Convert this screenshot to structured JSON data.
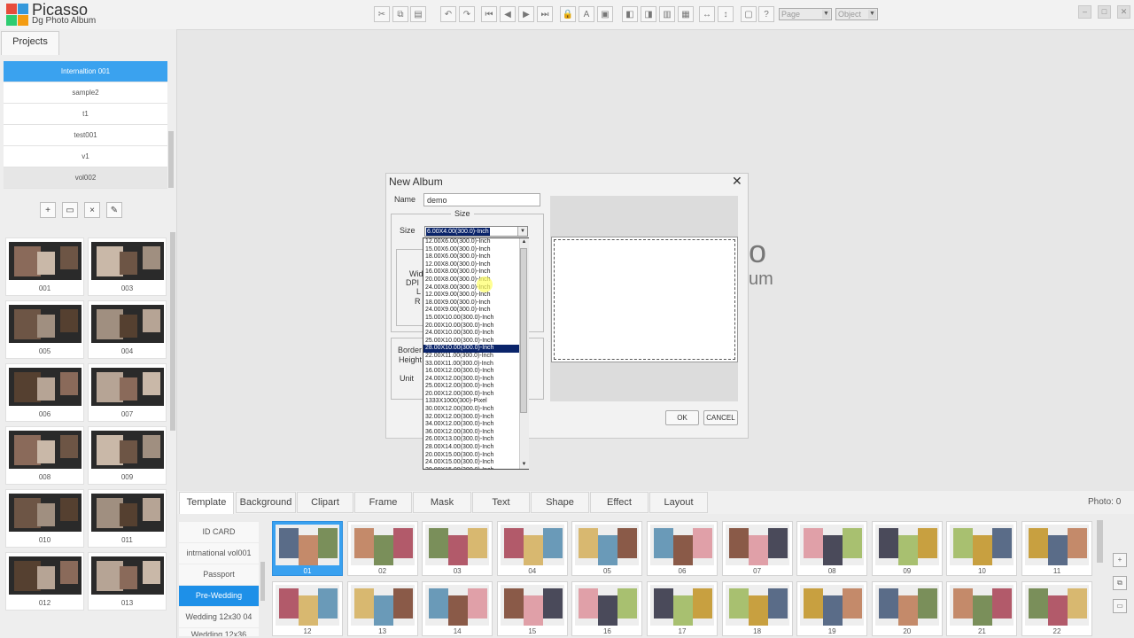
{
  "app": {
    "brand": "Picasso",
    "subtitle": "Dg Photo Album"
  },
  "toolbar": {
    "page_select": "Page",
    "object_select": "Object",
    "icons": [
      "scissors-icon",
      "copy-icon",
      "paste-icon",
      "undo-icon",
      "redo-icon",
      "first-page-icon",
      "prev-page-icon",
      "next-page-icon",
      "last-page-icon",
      "lock-icon",
      "text-layer-icon",
      "photo-layer-icon",
      "bring-front-icon",
      "send-back-icon",
      "bring-forward-icon",
      "send-backward-icon",
      "align-horizontal-icon",
      "align-vertical-icon",
      "comment-icon",
      "help-icon"
    ]
  },
  "left_panel": {
    "tab_label": "Projects",
    "projects": [
      "Internaltion 001",
      "sample2",
      "t1",
      "test001",
      "v1",
      "vol002"
    ],
    "selected_project": "Internaltion 001",
    "thumbnails": [
      "001",
      "003",
      "005",
      "004",
      "006",
      "007",
      "008",
      "009",
      "010",
      "011",
      "012",
      "013"
    ]
  },
  "workspace": {
    "bg_text_1": "o",
    "bg_text_2": "um"
  },
  "dialog": {
    "title": "New Album",
    "close_glyph": "✕",
    "name_label": "Name",
    "name_value": "demo",
    "size_group_label": "Size",
    "size_label": "Size",
    "size_selected": "6.00X4.00(300.0)-Inch",
    "side_labels": [
      "Wid",
      "DPI",
      "L",
      "R"
    ],
    "border_label": "Border",
    "height_label": "Height",
    "unit_label": "Unit",
    "size_options": [
      "12.00X6.00(300.0)-Inch",
      "15.00X6.00(300.0)-Inch",
      "18.00X6.00(300.0)-Inch",
      "12.00X8.00(300.0)-Inch",
      "16.00X8.00(300.0)-Inch",
      "20.00X8.00(300.0)-Inch",
      "24.00X8.00(300.0)-Inch",
      "12.00X9.00(300.0)-Inch",
      "18.00X9.00(300.0)-Inch",
      "24.00X9.00(300.0)-Inch",
      "15.00X10.00(300.0)-Inch",
      "20.00X10.00(300.0)-Inch",
      "24.00X10.00(300.0)-Inch",
      "25.00X10.00(300.0)-Inch",
      "28.00X10.00(300.0)-Inch",
      "22.00X11.00(300.0)-Inch",
      "33.00X11.00(300.0)-Inch",
      "16.00X12.00(300.0)-Inch",
      "24.00X12.00(300.0)-Inch",
      "25.00X12.00(300.0)-Inch",
      "20.00X12.00(300.0)-Inch",
      "1333X1000(300)-Pixel",
      "30.00X12.00(300.0)-Inch",
      "32.00X12.00(300.0)-Inch",
      "34.00X12.00(300.0)-Inch",
      "36.00X12.00(300.0)-Inch",
      "26.00X13.00(300.0)-Inch",
      "28.00X14.00(300.0)-Inch",
      "20.00X15.00(300.0)-Inch",
      "24.00X15.00(300.0)-Inch",
      "30.00X15.00(300.0)-Inch"
    ],
    "highlighted_option_index": 14,
    "ok_label": "OK",
    "cancel_label": "CANCEL"
  },
  "bottom": {
    "tabs": [
      "Template",
      "Background",
      "Clipart",
      "Frame",
      "Mask",
      "Text",
      "Shape",
      "Effect",
      "Layout"
    ],
    "active_tab": "Template",
    "photo_count": "Photo: 0",
    "categories": [
      "ID CARD",
      "intrnational vol001",
      "Passport",
      "Pre-Wedding",
      "Wedding 12x30 04",
      "Wedding 12x36"
    ],
    "selected_category": "Pre-Wedding",
    "templates_row1": [
      "01",
      "02",
      "03",
      "04",
      "05",
      "06",
      "07",
      "08",
      "09",
      "10",
      "11"
    ],
    "templates_row2": [
      "12",
      "13",
      "14",
      "15",
      "16",
      "17",
      "18",
      "19",
      "20",
      "21",
      "22"
    ],
    "selected_template": "01"
  },
  "colors": {
    "accent": "#1e90e8",
    "selection_blue": "#3aa2ef",
    "list_highlight": "#0a246a"
  }
}
